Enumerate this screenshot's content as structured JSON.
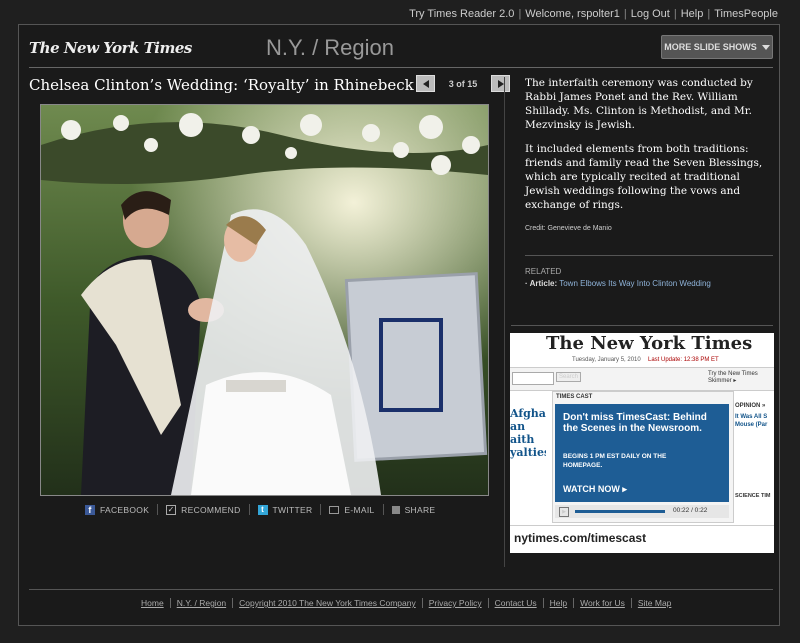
{
  "top_nav": {
    "items": [
      "Try Times Reader 2.0",
      "Welcome, rspolter1",
      "Log Out",
      "Help",
      "TimesPeople"
    ]
  },
  "header": {
    "logo_text": "The New York Times",
    "section": "N.Y. / Region",
    "more_button": "MORE SLIDE SHOWS"
  },
  "slide": {
    "title": "Chelsea Clinton’s Wedding: ‘Royalty’ in Rhinebeck",
    "counter": "3 of 15",
    "image_alt": "Wedding couple holding hands under a floral chuppah",
    "caption_p1": "The interfaith ceremony was conducted by Rabbi James Ponet and the Rev. William Shillady. Ms. Clinton is Methodist, and Mr. Mezvinsky is Jewish.",
    "caption_p2": "It included elements from both traditions: friends and family read the Seven Blessings, which are typically recited at traditional Jewish weddings following the vows and exchange of rings.",
    "credit": "Credit: Genevieve de Manio"
  },
  "share": {
    "facebook": "FACEBOOK",
    "recommend": "RECOMMEND",
    "twitter": "TWITTER",
    "email": "E-MAIL",
    "share": "SHARE"
  },
  "related": {
    "label": "RELATED",
    "prefix": "· Article:",
    "link": "Town Elbows Its Way Into Clinton Wedding"
  },
  "ad": {
    "masthead": "The New York Times",
    "date_line": "Tuesday, January 5, 2010",
    "updated": "Last Update: 12:38 PM ET",
    "search_btn": "Search",
    "skimmer": "Try the New Times Skimmer ▸",
    "section_label": "TIMES CAST",
    "left_headline": "Afghan an aith yalties",
    "headline": "Don't miss TimesCast: Behind the Scenes in the Newsroom.",
    "schedule": "BEGINS 1 PM EST DAILY ON THE HOMEPAGE.",
    "watch": "WATCH NOW ▸",
    "time": "00:22 / 0:22",
    "opinion": "OPINION »",
    "opinion_item": "It Was All S Mouse (Par",
    "science": "SCIENCE TIM",
    "url": "nytimes.com/timescast",
    "colors": {
      "blue": "#1e5d95",
      "link": "#12548a"
    }
  },
  "footer": {
    "links": [
      "Home",
      "N.Y. / Region",
      "Copyright 2010 The New York Times Company",
      "Privacy Policy",
      "Contact Us",
      "Help",
      "Work for Us",
      "Site Map"
    ]
  }
}
